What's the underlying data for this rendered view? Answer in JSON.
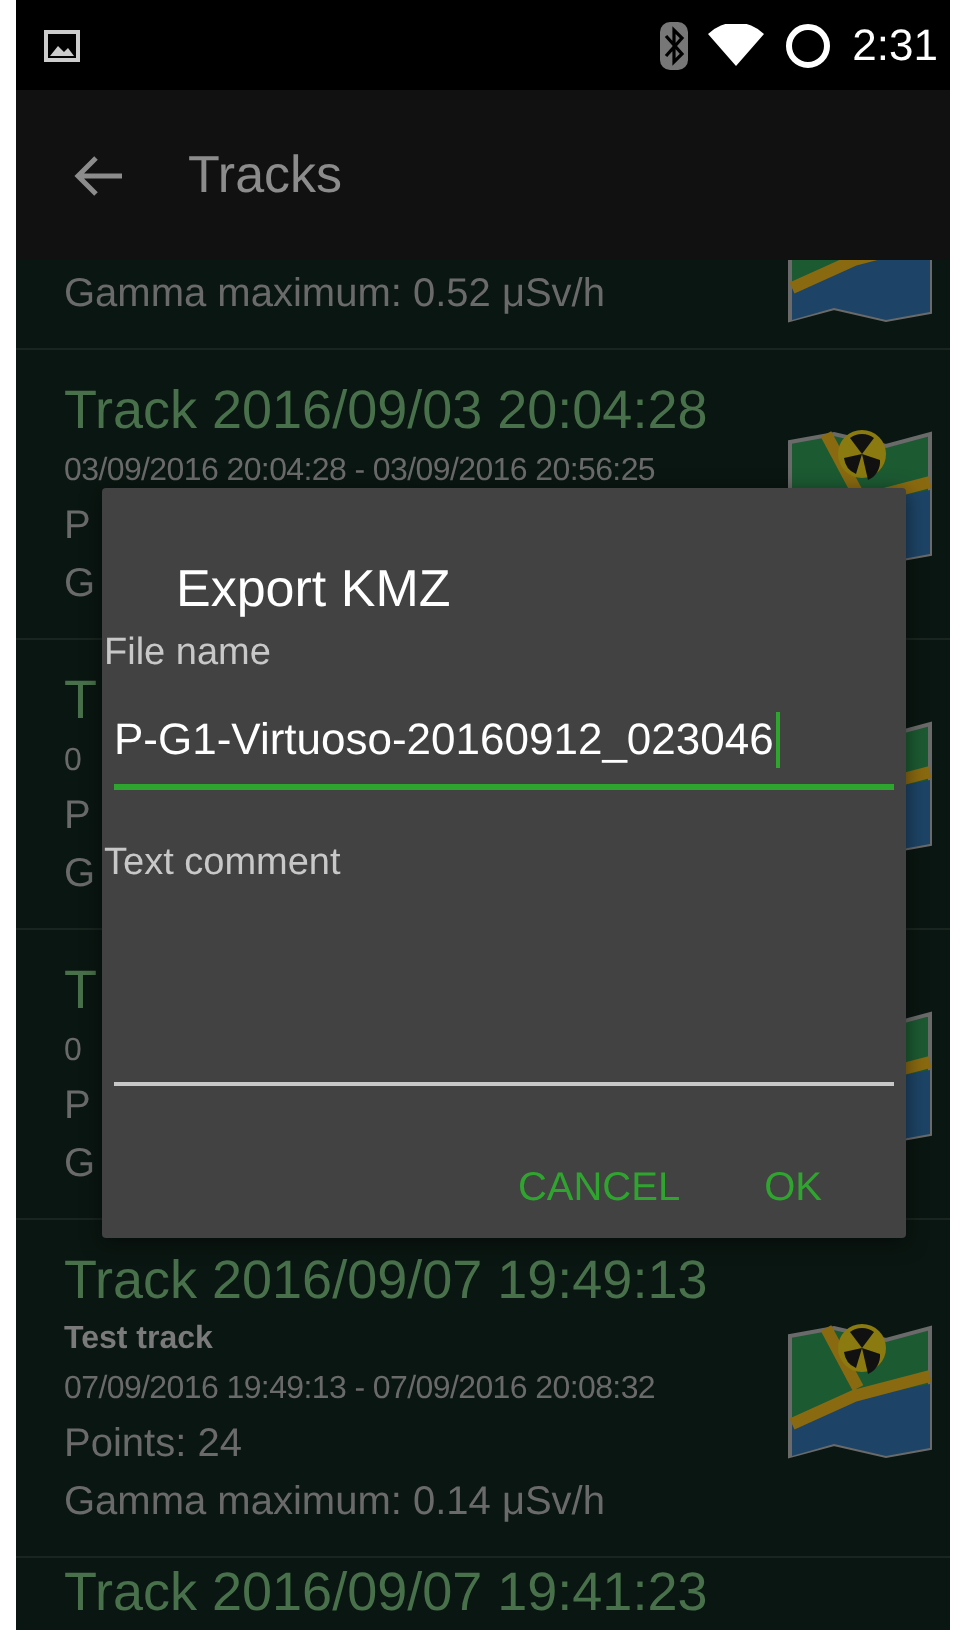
{
  "status_bar": {
    "time": "2:31"
  },
  "app_bar": {
    "title": "Tracks"
  },
  "tracks": [
    {
      "gamma": "Gamma maximum: 0.52  μSv/h"
    },
    {
      "title": "Track 2016/09/03 20:04:28",
      "dates": "03/09/2016 20:04:28 - 03/09/2016 20:56:25",
      "points": "P",
      "gamma": "G"
    },
    {
      "title": "T",
      "dates": "0",
      "points": "P",
      "gamma": "G"
    },
    {
      "title": "T",
      "dates": "0",
      "points": "P",
      "gamma": "G"
    },
    {
      "title": "Track 2016/09/07 19:49:13",
      "note": "Test track",
      "dates": "07/09/2016 19:49:13 - 07/09/2016 20:08:32",
      "points": "Points: 24",
      "gamma": "Gamma maximum: 0.14  μSv/h"
    },
    {
      "title": "Track 2016/09/07 19:41:23"
    }
  ],
  "dialog": {
    "title": "Export KMZ",
    "fields": [
      {
        "label": "File name",
        "value": "P-G1-Virtuoso-20160912_023046",
        "focused": true
      },
      {
        "label": "Text comment",
        "focused": false
      }
    ],
    "buttons": [
      "CANCEL",
      "OK"
    ]
  }
}
